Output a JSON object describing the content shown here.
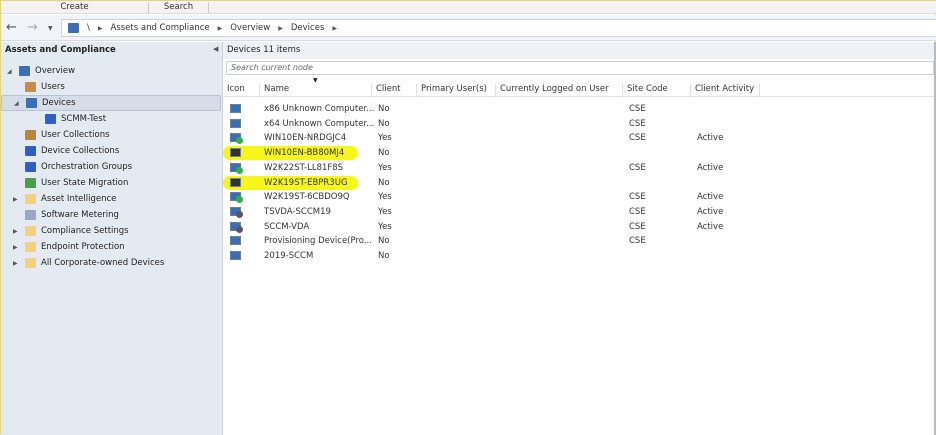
{
  "ribbon": {
    "tabs": [
      "Create",
      "Search"
    ]
  },
  "nav": {
    "path": [
      "\\",
      "Assets and Compliance",
      "Overview",
      "Devices"
    ]
  },
  "left": {
    "title": "Assets and Compliance",
    "items": [
      {
        "label": "Overview",
        "icon": "overview-icon",
        "level": 0,
        "expander": "expanded"
      },
      {
        "label": "Users",
        "icon": "users-icon",
        "level": 1
      },
      {
        "label": "Devices",
        "icon": "devices-icon",
        "level": 1,
        "expander": "expanded",
        "selected": true
      },
      {
        "label": "SCMM-Test",
        "icon": "collection-icon",
        "level": 2
      },
      {
        "label": "User Collections",
        "icon": "user-collections-icon",
        "level": 1
      },
      {
        "label": "Device Collections",
        "icon": "device-collections-icon",
        "level": 1
      },
      {
        "label": "Orchestration Groups",
        "icon": "orchestration-icon",
        "level": 1
      },
      {
        "label": "User State Migration",
        "icon": "user-state-icon",
        "level": 1
      },
      {
        "label": "Asset Intelligence",
        "icon": "folder-icon",
        "level": 1,
        "expander": "collapsed"
      },
      {
        "label": "Software Metering",
        "icon": "metering-icon",
        "level": 1
      },
      {
        "label": "Compliance Settings",
        "icon": "folder-icon",
        "level": 1,
        "expander": "collapsed"
      },
      {
        "label": "Endpoint Protection",
        "icon": "folder-icon",
        "level": 1,
        "expander": "collapsed"
      },
      {
        "label": "All Corporate-owned Devices",
        "icon": "folder-icon",
        "level": 1,
        "expander": "collapsed"
      }
    ]
  },
  "main": {
    "title": "Devices 11 items",
    "search_placeholder": "Search current node",
    "columns": [
      "Icon",
      "Name",
      "Client",
      "Primary User(s)",
      "Currently Logged on User",
      "Site Code",
      "Client Activity"
    ],
    "rows": [
      {
        "name": "x86 Unknown Computer...",
        "client": "No",
        "site": "CSE",
        "activity": "",
        "status": "none",
        "highlight": false
      },
      {
        "name": "x64 Unknown Computer...",
        "client": "No",
        "site": "CSE",
        "activity": "",
        "status": "none",
        "highlight": false
      },
      {
        "name": "WIN10EN-NRDGJC4",
        "client": "Yes",
        "site": "CSE",
        "activity": "Active",
        "status": "ok",
        "highlight": false
      },
      {
        "name": "WIN10EN-BB80MJ4",
        "client": "No",
        "site": "",
        "activity": "",
        "status": "none",
        "highlight": true
      },
      {
        "name": "W2K22ST-LL81F8S",
        "client": "Yes",
        "site": "CSE",
        "activity": "Active",
        "status": "ok",
        "highlight": false
      },
      {
        "name": "W2K19ST-EBPR3UG",
        "client": "No",
        "site": "",
        "activity": "",
        "status": "none",
        "highlight": true
      },
      {
        "name": "W2K19ST-6CBDO9Q",
        "client": "Yes",
        "site": "CSE",
        "activity": "Active",
        "status": "ok",
        "highlight": false
      },
      {
        "name": "TSVDA-SCCM19",
        "client": "Yes",
        "site": "CSE",
        "activity": "Active",
        "status": "server",
        "highlight": false
      },
      {
        "name": "SCCM-VDA",
        "client": "Yes",
        "site": "CSE",
        "activity": "Active",
        "status": "server",
        "highlight": false
      },
      {
        "name": "Provisioning Device(Pro...",
        "client": "No",
        "site": "CSE",
        "activity": "",
        "status": "none",
        "highlight": false
      },
      {
        "name": "2019-SCCM",
        "client": "No",
        "site": "",
        "activity": "",
        "status": "none",
        "highlight": false
      }
    ]
  },
  "colors": {
    "highlight": "#f5f500",
    "selected": "#d6dde8",
    "panel": "#e4eaf2",
    "ok_badge": "#2db34a"
  }
}
